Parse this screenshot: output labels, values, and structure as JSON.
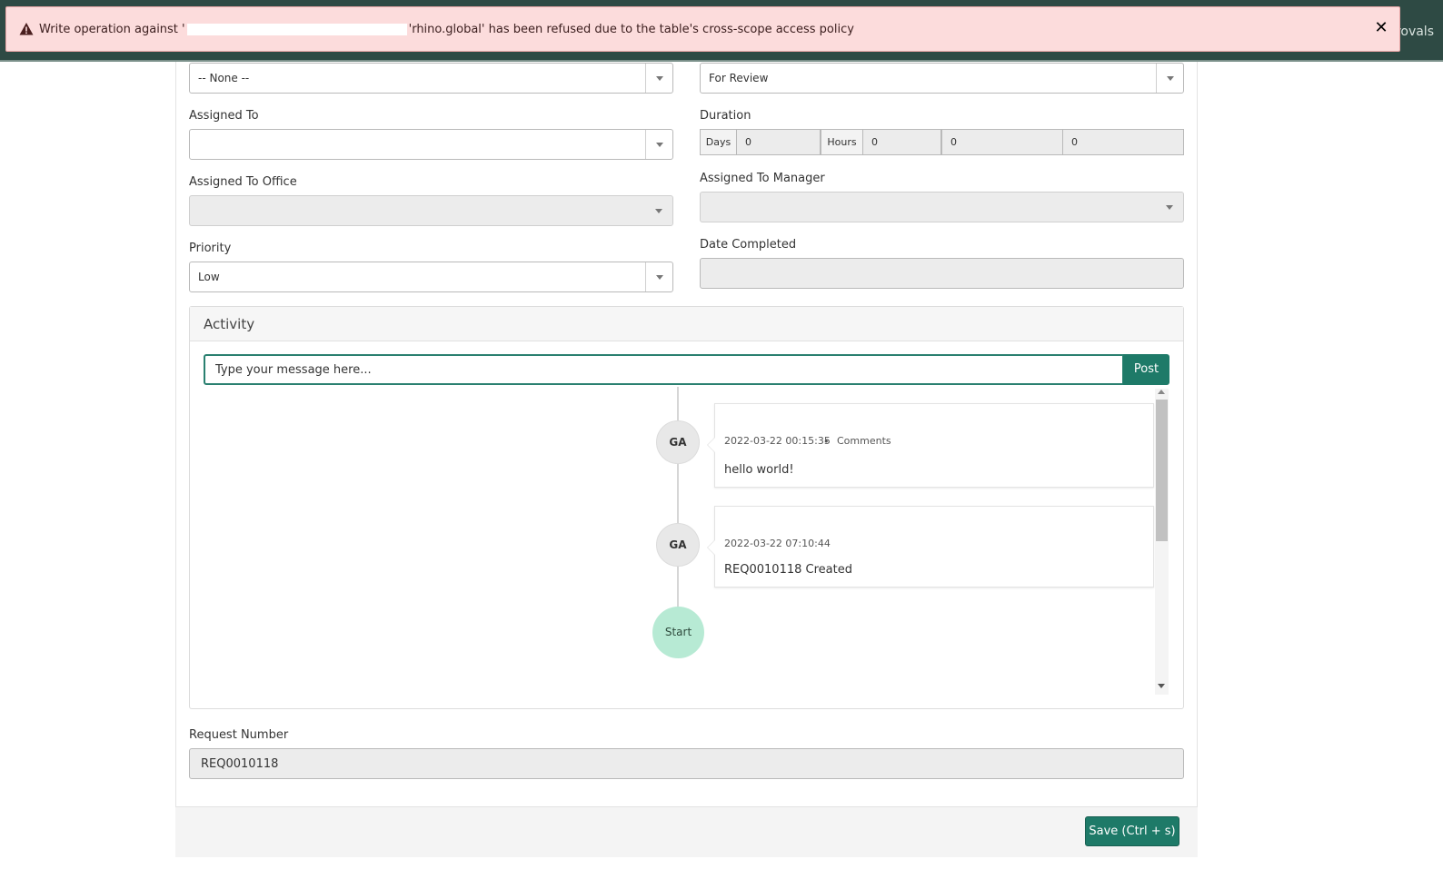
{
  "topbar": {
    "right_text": "provals"
  },
  "alert": {
    "icon": "warning-triangle-icon",
    "prefix": "Write operation against '",
    "suffix": "'rhino.global' has been refused due to the table's cross-scope access policy",
    "close_icon": "close-icon"
  },
  "form": {
    "top_left_select": {
      "value": "-- None --"
    },
    "top_right_select": {
      "value": "For Review"
    },
    "assigned_to": {
      "label": "Assigned To",
      "value": ""
    },
    "duration": {
      "label": "Duration",
      "days_label": "Days",
      "days_value": "0",
      "hours_label": "Hours",
      "hours_value": "0",
      "minutes_value": "0",
      "seconds_value": "0"
    },
    "assigned_to_office": {
      "label": "Assigned To Office",
      "value": ""
    },
    "assigned_to_manager": {
      "label": "Assigned To Manager",
      "value": ""
    },
    "priority": {
      "label": "Priority",
      "value": "Low"
    },
    "date_completed": {
      "label": "Date Completed",
      "value": ""
    },
    "request_number": {
      "label": "Request Number",
      "value": "REQ0010118"
    }
  },
  "activity": {
    "title": "Activity",
    "input_placeholder": "Type your message here...",
    "post_label": "Post",
    "entries": [
      {
        "avatar": "GA",
        "timestamp": "2022-03-22 00:15:35",
        "separator": "•",
        "type": "Comments",
        "body": "hello world!"
      },
      {
        "avatar": "GA",
        "timestamp": "2022-03-22 07:10:44",
        "type": "",
        "body": "REQ0010118 Created"
      }
    ],
    "start_label": "Start"
  },
  "footer": {
    "save_label": "Save (Ctrl + s)"
  }
}
